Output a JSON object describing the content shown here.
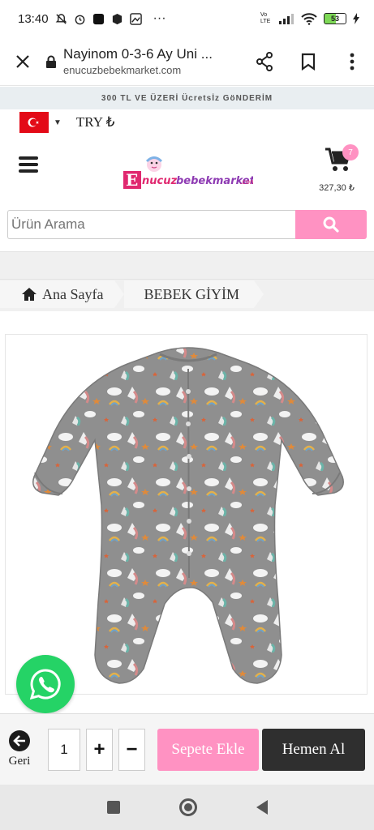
{
  "status_bar": {
    "time": "13:40",
    "more": "···",
    "volte_label": "Vo LTE",
    "battery_level": "53"
  },
  "browser": {
    "page_title": "Nayinom 0-3-6 Ay Uni ...",
    "url": "enucuzbebekmarket.com"
  },
  "promo": {
    "text": "300 TL VE ÜZERİ Ücretsİz GöNDERİM"
  },
  "header": {
    "currency": "TRY ₺",
    "logo_text": "Enucuzbebekmarket.com",
    "cart_count": "7",
    "cart_total": "327,30 ₺"
  },
  "search": {
    "placeholder": "Ürün Arama"
  },
  "breadcrumb": {
    "home": "Ana Sayfa",
    "category": "BEBEK GİYİM"
  },
  "actions": {
    "back_label": "Geri",
    "quantity": "1",
    "plus": "+",
    "minus": "−",
    "add_to_cart": "Sepete Ekle",
    "buy_now": "Hemen Al"
  },
  "colors": {
    "brand_pink": "#ff92c2",
    "dark_button": "#2f2f2f",
    "whatsapp_green": "#25d366"
  }
}
